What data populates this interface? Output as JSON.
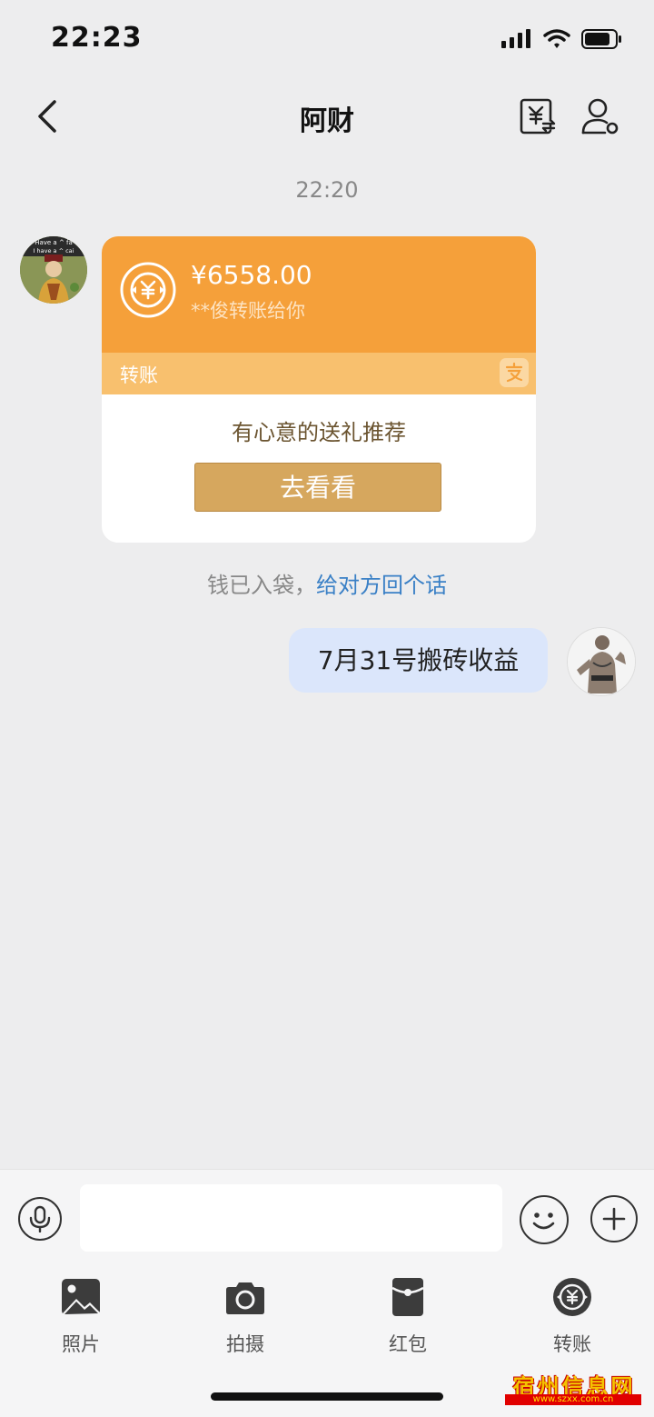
{
  "status_bar": {
    "time": "22:23",
    "signal": "signal-icon",
    "wifi": "wifi-icon",
    "battery": "battery-icon"
  },
  "nav": {
    "title": "阿财",
    "back": "back-icon",
    "transfer": "transfer-icon",
    "profile": "profile-icon"
  },
  "chat": {
    "timestamp": "22:20",
    "transfer_card": {
      "amount": "¥6558.00",
      "sender_text": "**俊转账给你",
      "type_label": "转账",
      "gift_text": "有心意的送礼推荐",
      "button_label": "去看看",
      "colors": {
        "top": "#f5a03a",
        "strip": "#f8c06e",
        "button": "#d6a75e"
      }
    },
    "system_note": {
      "text": "钱已入袋，",
      "link": "给对方回个话"
    },
    "message": {
      "text": "7月31号搬砖收益"
    },
    "avatar_left_text": [
      "Have a ^ fa",
      "I have a ^ cai"
    ]
  },
  "input": {
    "value": ""
  },
  "tools": [
    {
      "label": "照片",
      "icon": "photo-icon"
    },
    {
      "label": "拍摄",
      "icon": "camera-icon"
    },
    {
      "label": "红包",
      "icon": "red-packet-icon"
    },
    {
      "label": "转账",
      "icon": "transfer-icon"
    }
  ],
  "watermark": {
    "text": "宿州信息网",
    "url": "www.szxx.com.cn"
  },
  "colors": {
    "background": "#ededee",
    "link": "#3a80c6",
    "bubble": "#dbe6fb"
  }
}
